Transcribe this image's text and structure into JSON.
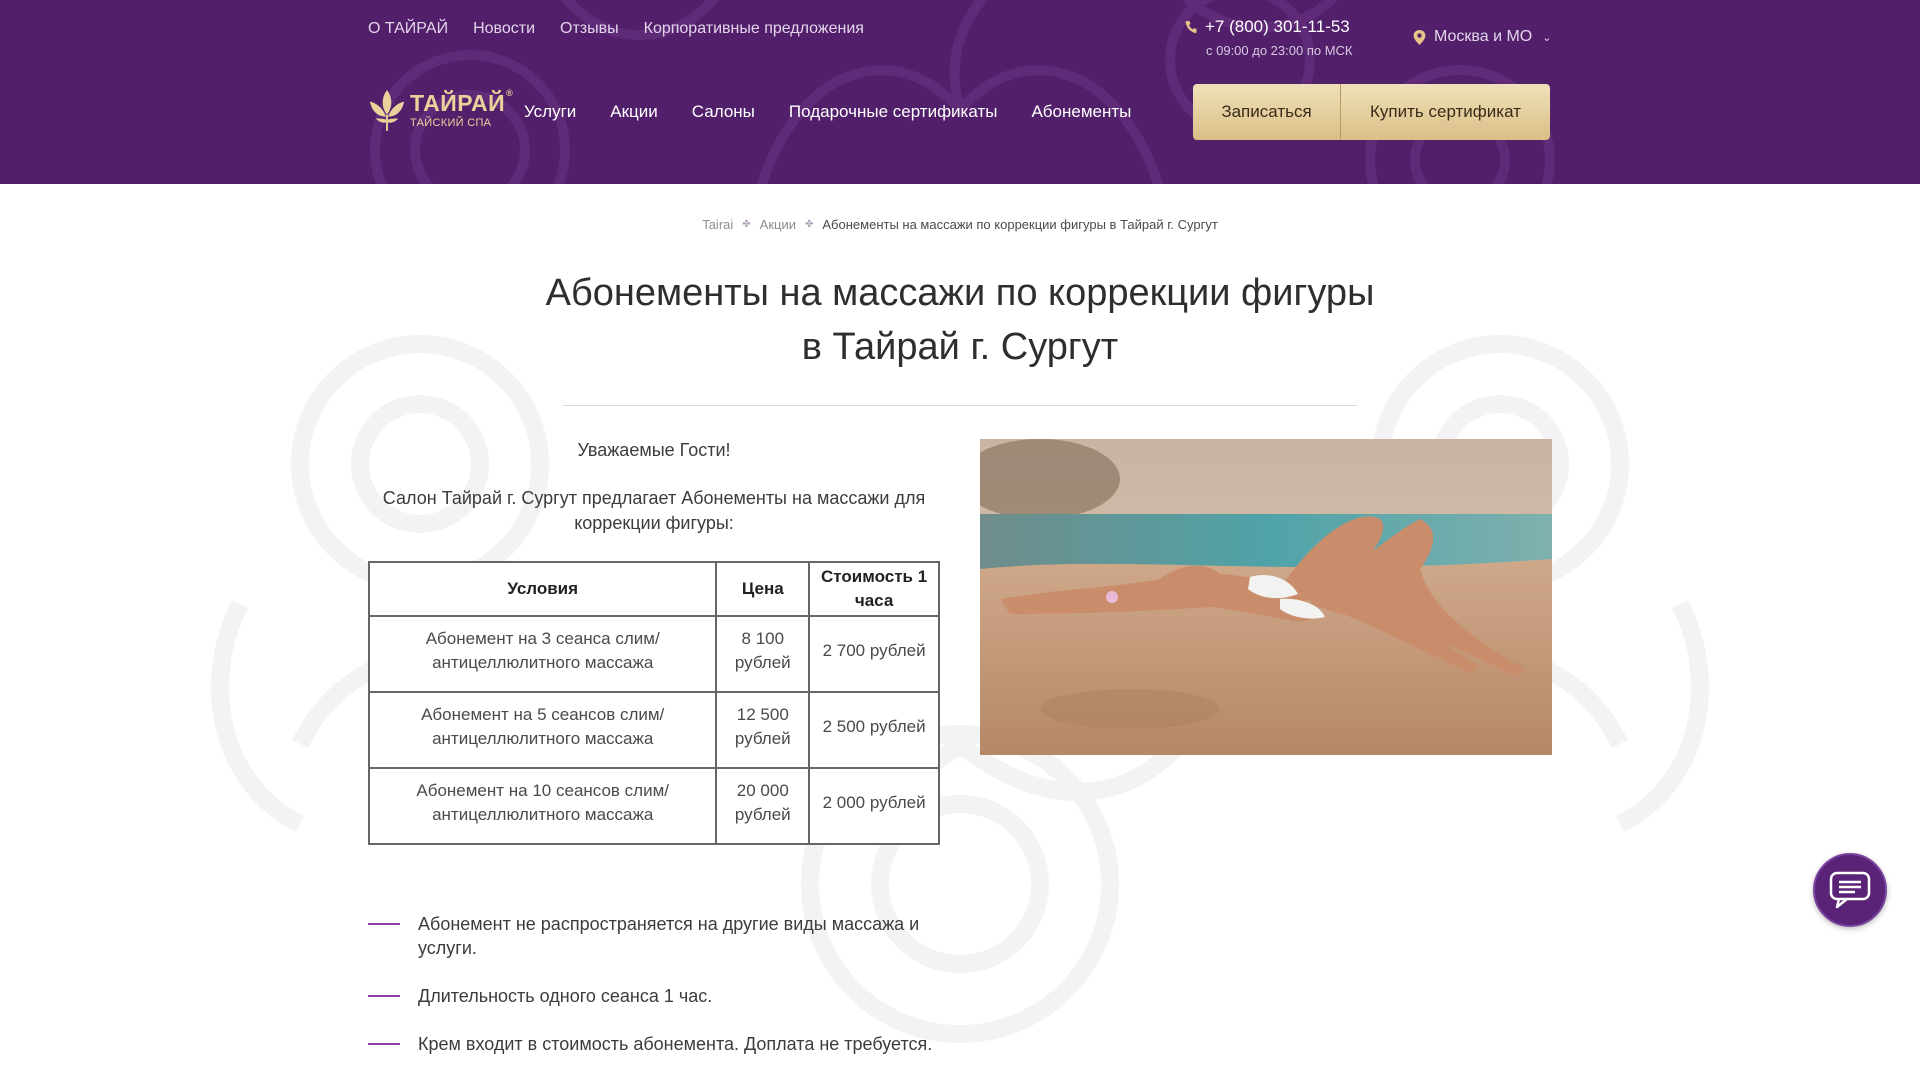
{
  "colors": {
    "header_bg": "#521f6b",
    "gold": "#e9d39b",
    "accent_dash": "#8e3aa8",
    "chat_bg": "#5a2377"
  },
  "header": {
    "top_links": [
      "О ТАЙРАЙ",
      "Новости",
      "Отзывы",
      "Корпоративные предложения"
    ],
    "phone": "+7 (800) 301-11-53",
    "hours": "с 09:00 до 23:00 по МСК",
    "region": "Москва и МО",
    "logo_name": "ТАЙРАЙ",
    "logo_reg": "®",
    "logo_sub": "ТАЙСКИЙ СПА",
    "main_links": [
      "Услуги",
      "Акции",
      "Салоны",
      "Подарочные сертификаты",
      "Абонементы"
    ],
    "signup_label": "Записаться",
    "certificate_label": "Купить сертификат"
  },
  "icons": {
    "phone": "phone-icon",
    "region": "location-pin-icon",
    "dropdown": "chevron-down-icon",
    "breadcrumb_sep": "leaf-separator-icon",
    "chat": "chat-bubble-icon",
    "logo": "lotus-logo-icon"
  },
  "breadcrumb": {
    "items": [
      "Tairai",
      "Акции"
    ],
    "current": "Абонементы на массажи по коррекции фигуры в Тайрай г. Сургут",
    "separator": "✤"
  },
  "page": {
    "title_line1": "Абонементы на массажи по коррекции фигуры",
    "title_line2": "в Тайрай г. Сургут",
    "greeting": "Уважаемые Гости!",
    "intro": "Салон Тайрай г. Сургут предлагает Абонементы на массажи для коррекции фигуры:"
  },
  "table": {
    "headers": [
      "Условия",
      "Цена",
      "Стоимость 1 часа"
    ],
    "rows": [
      [
        "Абонемент на 3 сеанса слим/ антицеллюлитного массажа",
        "8 100 рублей",
        "2 700 рублей"
      ],
      [
        "Абонемент на 5 сеансов  слим/ антицеллюлитного массажа",
        "12 500 рублей",
        "2 500 рублей"
      ],
      [
        "Абонемент на 10 сеансов  слим/ антицеллюлитного массажа",
        "20 000 рублей",
        "2 000 рублей"
      ]
    ]
  },
  "notes": [
    "Абонемент не распространяется на другие виды массажа и услуги.",
    "Длительность одного сеанса 1 час.",
    "Крем входит в стоимость абонемента. Доплата не требуется."
  ]
}
